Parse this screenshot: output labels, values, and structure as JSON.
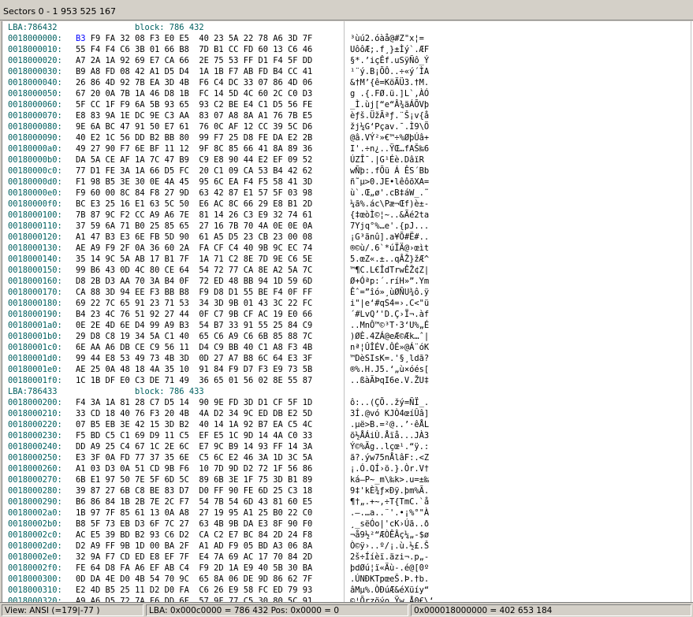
{
  "window": {
    "title": "Sectors 0 - 1 953 525 167"
  },
  "blocks": [
    {
      "lba_label": "LBA:786432",
      "block_label": "block: 786 432",
      "rows": [
        {
          "offset": "0018000000:",
          "hex_first": "B3",
          "hex": " F9 FA 32 08 F3 E0 E5  40 23 5A 22 78 A6 3D 7F",
          "ascii": "³ùú2.óàå@#Z\"x¦="
        },
        {
          "offset": "0018000010:",
          "hex_first": "",
          "hex": "55 F4 F4 C6 3B 01 66 B8  7D B1 CC FD 60 13 C6 46",
          "ascii": "UôôÆ;.f¸}±Ìý`.ÆF"
        },
        {
          "offset": "0018000020:",
          "hex_first": "",
          "hex": "A7 2A 1A 92 69 E7 CA 66  2E 75 53 FF D1 F4 5F DD",
          "ascii": "§*.’içÊf.uSÿÑô_Ý"
        },
        {
          "offset": "0018000030:",
          "hex_first": "",
          "hex": "B9 A8 FD 08 42 A1 D5 D4  1A 1B F7 AB FD B4 CC 41",
          "ascii": "¹¨ý.B¡ÕÔ..÷«ý´ÌA"
        },
        {
          "offset": "0018000040:",
          "hex_first": "",
          "hex": "26 86 4D 92 7B EA 3D 4B  F6 C4 DC 33 07 86 4D 06",
          "ascii": "&†M’{ê=KöÄÜ3.†M."
        },
        {
          "offset": "0018000050:",
          "hex_first": "",
          "hex": "67 20 0A 7B 1A 46 D8 1B  FC 14 5D 4C 60 2C C0 D3",
          "ascii": "g .{.FØ.ü.]L`,ÀÓ"
        },
        {
          "offset": "0018000060:",
          "hex_first": "",
          "hex": "5F CC 1F F9 6A 5B 93 65  93 C2 BE E4 C1 D5 56 FE",
          "ascii": "_Ì.ùj[“e“Â¾äÁÕVþ"
        },
        {
          "offset": "0018000070:",
          "hex_first": "",
          "hex": "E8 83 9A 1E DC 9E C3 AA  83 07 A8 8A A1 76 7B E5",
          "ascii": "èƒš.ÜžÃªƒ.¨Š¡v{å"
        },
        {
          "offset": "0018000080:",
          "hex_first": "",
          "hex": "9E 6A BC 47 91 50 E7 61  76 0C AF 12 CC 39 5C D6",
          "ascii": "žj¼G‘Pçav.¯.Ì9\\Ö"
        },
        {
          "offset": "0018000090:",
          "hex_first": "",
          "hex": "40 E2 1C 56 DD B2 BB 80  99 F7 25 D8 FE DA E2 2B",
          "ascii": "@â.VÝ²»€™÷%ØþÚâ+"
        },
        {
          "offset": "00180000a0:",
          "hex_first": "",
          "hex": "49 27 90 F7 6E BF 11 12  9F 8C 85 66 41 8A 89 36",
          "ascii": "I'.÷n¿..ŸŒ…fAŠ‰6"
        },
        {
          "offset": "00180000b0:",
          "hex_first": "",
          "hex": "DA 5A CE AF 1A 7C 47 B9  C9 E8 90 44 E2 EF 09 52",
          "ascii": "ÚZÎ¯.|G¹Éè.DâïR"
        },
        {
          "offset": "00180000c0:",
          "hex_first": "",
          "hex": "77 D1 FE 3A 1A 66 D5 FC  20 C1 09 CA 53 B4 42 62",
          "ascii": "wÑþ:.fÕü Á ÊS´Bb"
        },
        {
          "offset": "00180000d0:",
          "hex_first": "",
          "hex": "F1 98 B5 3E 30 0E 4A 45  95 6C EA F4 F5 58 41 3D",
          "ascii": "ñ˜µ>0.JE•lêôõXA="
        },
        {
          "offset": "00180000e0:",
          "hex_first": "",
          "hex": "F9 60 00 8C 84 F8 27 9D  63 42 87 E1 57 5F 03 98",
          "ascii": "ù`.Œ„ø'.cB‡áW_.˜"
        },
        {
          "offset": "00180000f0:",
          "hex_first": "",
          "hex": "BC E3 25 16 E1 63 5C 50  E6 AC 8C 66 29 E8 B1 2D",
          "ascii": "¼ã%.ác\\Pæ¬Œf)è±-"
        },
        {
          "offset": "0018000100:",
          "hex_first": "",
          "hex": "7B 87 9C F2 CC A9 A6 7E  81 14 26 C3 E9 32 74 61",
          "ascii": "{‡œòÌ©¦~..&Ãé2ta"
        },
        {
          "offset": "0018000110:",
          "hex_first": "",
          "hex": "37 59 6A 71 B0 25 85 65  27 16 7B 70 4A 0E 0E 0A",
          "ascii": "7Yjq°%…e'.{pJ..."
        },
        {
          "offset": "0018000120:",
          "hex_first": "",
          "hex": "A1 47 B3 E3 6E FB 5D 90  61 A5 D5 23 CB 23 00 08",
          "ascii": "¡G³ãnû].a¥Õ#Ë#.."
        },
        {
          "offset": "0018000130:",
          "hex_first": "",
          "hex": "AE A9 F9 2F 0A 36 60 2A  FA CF C4 40 9B 9C EC 74",
          "ascii": "®©ù/.6`*úÏÄ@›œìt"
        },
        {
          "offset": "0018000140:",
          "hex_first": "",
          "hex": "35 14 9C 5A AB 17 B1 7F  1A 71 C2 8E 7D 9E C6 5E",
          "ascii": "5.œZ«.±..qÂŽ}žÆ^"
        },
        {
          "offset": "0018000150:",
          "hex_first": "",
          "hex": "99 B6 43 0D 4C 80 CE 64  54 72 77 CA 8E A2 5A 7C",
          "ascii": "™¶C.L€ÎdTrwÊŽ¢Z|"
        },
        {
          "offset": "0018000160:",
          "hex_first": "",
          "hex": "D8 2B D3 AA 70 3A B4 0F  72 ED 48 BB 94 1D 59 6D",
          "ascii": "Ø+Óªp:´.ríH»”.Ym"
        },
        {
          "offset": "0018000170:",
          "hex_first": "",
          "hex": "CA 88 3D 94 EE F3 BB B8  F9 D8 D1 55 BE F4 0F FF",
          "ascii": "Êˆ=”îó»¸ùØÑU¾ô.ÿ"
        },
        {
          "offset": "0018000180:",
          "hex_first": "",
          "hex": "69 22 7C 65 91 23 71 53  34 3D 9B 01 43 3C 22 FC",
          "ascii": "i\"|e‘#qS4=›.C<\"ü"
        },
        {
          "offset": "0018000190:",
          "hex_first": "",
          "hex": "B4 23 4C 76 51 92 27 44  0F C7 9B CF AC 19 E0 66",
          "ascii": "´#LvQ’'D.Ç›Ï¬.àf"
        },
        {
          "offset": "00180001a0:",
          "hex_first": "",
          "hex": "0E 2E 4D 6E D4 99 A9 B3  54 B7 33 91 55 25 84 C9",
          "ascii": "..MnÔ™©³T·3‘U%„É"
        },
        {
          "offset": "00180001b0:",
          "hex_first": "",
          "hex": "29 D8 C8 19 34 5A C1 40  65 C6 A9 C6 6B 85 88 7C",
          "ascii": ")ØÈ.4ZÁ@eÆ©Æk…ˆ|"
        },
        {
          "offset": "00180001c0:",
          "hex_first": "",
          "hex": "6E AA A6 DB CE C9 56 11  D4 C9 BB 40 C1 A8 F3 4B",
          "ascii": "nª¦ÛÎÉV.ÔÉ»@Á¨óK"
        },
        {
          "offset": "00180001d0:",
          "hex_first": "",
          "hex": "99 44 E8 53 49 73 4B 3D  0D 27 A7 B8 6C 64 E3 3F",
          "ascii": "™DèSIsK=.'§¸ldã?"
        },
        {
          "offset": "00180001e0:",
          "hex_first": "",
          "hex": "AE 25 0A 48 18 4A 35 10  91 84 F9 D7 F3 E9 73 5B",
          "ascii": "®%.H.J5.‘„ù×óés["
        },
        {
          "offset": "00180001f0:",
          "hex_first": "",
          "hex": "1C 1B DF E0 C3 DE 71 49  36 65 01 56 02 8E 55 87",
          "ascii": "..ßàÃÞqI6e.V.ŽU‡"
        }
      ]
    },
    {
      "lba_label": "LBA:786433",
      "block_label": "block: 786 433",
      "rows": [
        {
          "offset": "0018000200:",
          "hex_first": "",
          "hex": "F4 3A 1A 81 28 C7 D5 14  90 9E FD 3D D1 CF 5F 1D",
          "ascii": "ô:..(ÇÕ..žý=ÑÏ_."
        },
        {
          "offset": "0018000210:",
          "hex_first": "",
          "hex": "33 CD 18 40 76 F3 20 4B  4A D2 34 9C ED DB E2 5D",
          "ascii": "3Í.@vó KJÒ4œíÛâ]"
        },
        {
          "offset": "0018000220:",
          "hex_first": "",
          "hex": "07 B5 EB 3E 42 15 3D B2  40 14 1A 92 B7 EA C5 4C",
          "ascii": ".µë>B.=²@..’·êÅL"
        },
        {
          "offset": "0018000230:",
          "hex_first": "",
          "hex": "F5 BD C5 C1 69 D9 11 C5  EF E5 1C 9D 14 4A C0 33",
          "ascii": "õ½ÅÁiÙ.Åïå...JÀ3"
        },
        {
          "offset": "0018000240:",
          "hex_first": "",
          "hex": "DD A9 25 C4 67 1C 2E 6C  E7 9C B9 14 93 FF 14 3A",
          "ascii": "Ý©%Äg..lçœ¹.“ÿ.:"
        },
        {
          "offset": "0018000250:",
          "hex_first": "",
          "hex": "E3 3F 0A FD 77 37 35 6E  C5 6C E2 46 3A 1D 3C 5A",
          "ascii": "ã?.ýw75nÅlâF:.<Z"
        },
        {
          "offset": "0018000260:",
          "hex_first": "",
          "hex": "A1 03 D3 0A 51 CD 9B F6  10 7D 9D D2 72 1F 56 86",
          "ascii": "¡.Ó.QÍ›ö.}.Òr.V†"
        },
        {
          "offset": "0018000270:",
          "hex_first": "",
          "hex": "6B E1 97 50 7E 5F 6D 5C  89 6B 3E 1F 75 3D B1 89",
          "ascii": "ká—P~_m\\‰k>.u=±‰"
        },
        {
          "offset": "0018000280:",
          "hex_first": "",
          "hex": "39 87 27 6B C8 BE 83 D7  D0 FF 90 FE 6D 25 C3 18",
          "ascii": "9‡'kÈ¾ƒ×Ðÿ.þm%Ã."
        },
        {
          "offset": "0018000290:",
          "hex_first": "",
          "hex": "B6 86 84 1B 2B 7E 2C F7  54 7B 54 6D 43 81 60 E5",
          "ascii": "¶†„.+~,÷T{TmC.`å"
        },
        {
          "offset": "00180002a0:",
          "hex_first": "",
          "hex": "1B 97 7F 85 61 13 0A A8  27 19 95 A1 25 B0 22 C0",
          "ascii": ".—.…a..¨'.•¡%°\"À"
        },
        {
          "offset": "00180002b0:",
          "hex_first": "",
          "hex": "B8 5F 73 EB D3 6F 7C 27  63 4B 9B DA E3 8F 90 F0",
          "ascii": "¸_sëÓo|'cK›Úã..ð"
        },
        {
          "offset": "00180002c0:",
          "hex_first": "",
          "hex": "AC E5 39 BD B2 93 C6 D2  CA C2 E7 BC 84 2D 24 F8",
          "ascii": "¬å9½²“ÆÒÊÂç¼„-$ø"
        },
        {
          "offset": "00180002d0:",
          "hex_first": "",
          "hex": "D2 A9 FF 9B 1D 00 BA 2F  A1 AD F9 05 BD A3 06 8A",
          "ascii": "Ò©ÿ›..º/¡.ù.½£.Š"
        },
        {
          "offset": "00180002e0:",
          "hex_first": "",
          "hex": "32 9A F7 CD ED E8 EF 7F  E4 7A 69 AC 17 70 84 2D",
          "ascii": "2š÷Ííèï.äzi¬.p„-"
        },
        {
          "offset": "00180002f0:",
          "hex_first": "",
          "hex": "FE 64 D8 FA A6 EF AB C4  F9 2D 1A E9 40 5B 30 BA",
          "ascii": "þdØú¦ï«Äù-.é@[0º"
        },
        {
          "offset": "0018000300:",
          "hex_first": "",
          "hex": "0D DA 4E D0 4B 54 70 9C  65 8A 06 DE 9D 86 62 7F",
          "ascii": ".ÚNÐKTpœeŠ.Þ.†b."
        },
        {
          "offset": "0018000310:",
          "hex_first": "",
          "hex": "E2 4D B5 25 11 D2 D0 FA  C6 26 E9 58 FC ED 79 93",
          "ascii": "âMµ%.ÒÐúÆ&éXüíy“"
        },
        {
          "offset": "0018000320:",
          "hex_first": "",
          "hex": "A9 A6 D5 72 7A F6 DD 6F  57 9F 77 C5 30 80 5C 91",
          "ascii": "©¦Õrzöýo.Ÿw Å0€\\‘"
        }
      ]
    }
  ],
  "statusbar": {
    "view": "View: ANSI (=179|-77 )",
    "lba": "LBA: 0x000c0000 = 786 432  Pos: 0x0000 = 0",
    "empty": "",
    "position": "0x000018000000 = 402 653 184"
  },
  "colors": {
    "offset": "#006060",
    "cursor_byte": "#0000ff",
    "background": "#ffffff",
    "chrome": "#d4d0c8"
  }
}
